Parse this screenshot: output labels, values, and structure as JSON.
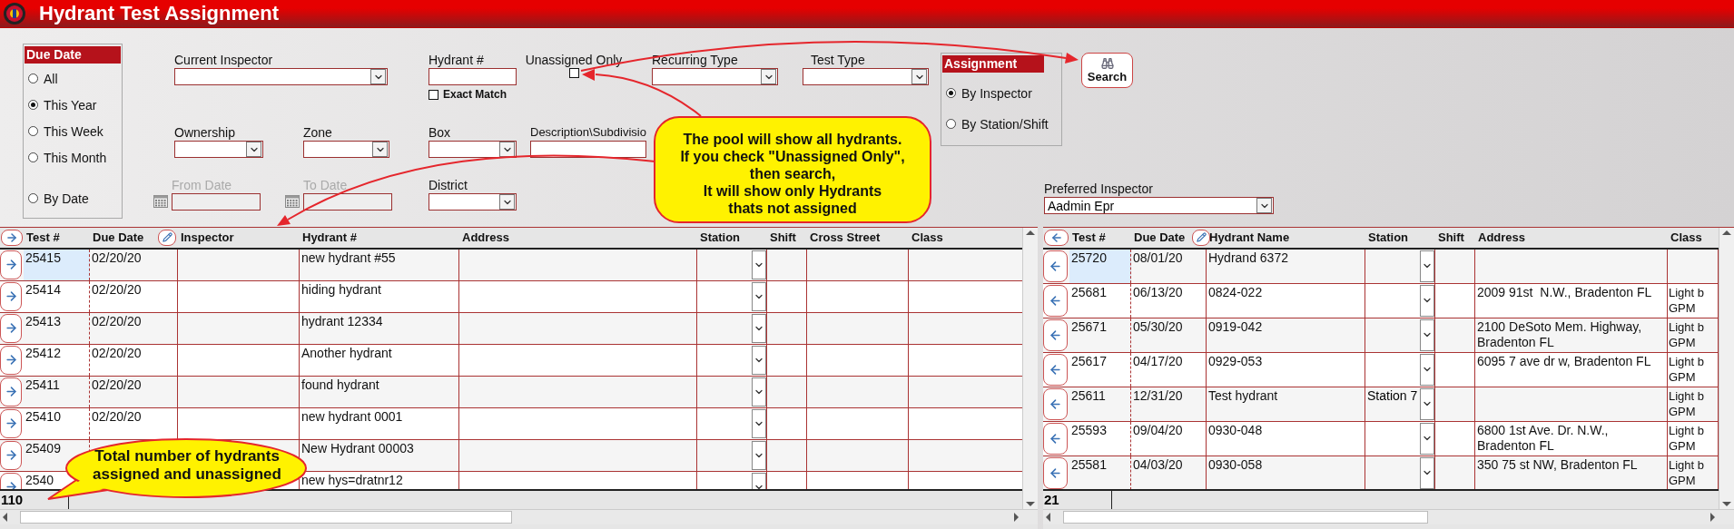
{
  "window": {
    "title": "Hydrant Test Assignment"
  },
  "due_date": {
    "title": "Due Date",
    "options": [
      {
        "label": "All",
        "selected": false
      },
      {
        "label": "This Year",
        "selected": true
      },
      {
        "label": "This Week",
        "selected": false
      },
      {
        "label": "This Month",
        "selected": false
      },
      {
        "label": "By Date",
        "selected": false
      }
    ]
  },
  "filter_rows": [
    [
      {
        "kind": "select",
        "label": "Current Inspector",
        "disabled": false
      },
      {
        "kind": "text",
        "label": "Hydrant #",
        "disabled": false,
        "option": {
          "label": "Exact Match",
          "checked": false
        }
      },
      {
        "kind": "checkbox",
        "label": "Unassigned Only",
        "disabled": false,
        "checked": false
      },
      {
        "kind": "select",
        "label": "Recurring Type",
        "disabled": false
      },
      {
        "kind": "select",
        "label": "Test Type",
        "disabled": false
      }
    ],
    [
      {
        "kind": "select",
        "label": "Ownership",
        "disabled": false
      },
      {
        "kind": "select",
        "label": "Zone",
        "disabled": false
      },
      {
        "kind": "select",
        "label": "Box",
        "disabled": false
      },
      {
        "kind": "text",
        "label": "Description\\Subdivisio",
        "disabled": false
      }
    ],
    [
      {
        "kind": "date",
        "label": "From Date",
        "disabled": true
      },
      {
        "kind": "date",
        "label": "To Date",
        "disabled": true
      },
      {
        "kind": "select",
        "label": "District",
        "disabled": false
      }
    ]
  ],
  "assignment": {
    "title": "Assignment",
    "options": [
      {
        "label": "By Inspector",
        "selected": true
      },
      {
        "label": "By Station/Shift",
        "selected": false
      }
    ]
  },
  "search_button": {
    "label": "Search"
  },
  "preferred_inspector": {
    "label": "Preferred Inspector",
    "value": "Aadmin Epr"
  },
  "pool_table": {
    "columns": [
      "Test #",
      "Due Date",
      "Inspector",
      "Hydrant #",
      "Address",
      "Station",
      "Shift",
      "Cross Street",
      "Class"
    ],
    "rows": [
      {
        "test": "25415",
        "due_date": "02/20/20",
        "hydrant": "new hydrant #55",
        "selected": true
      },
      {
        "test": "25414",
        "due_date": "02/20/20",
        "hydrant": "hiding hydrant",
        "selected": false
      },
      {
        "test": "25413",
        "due_date": "02/20/20",
        "hydrant": "hydrant 12334",
        "selected": false
      },
      {
        "test": "25412",
        "due_date": "02/20/20",
        "hydrant": "Another hydrant",
        "selected": false
      },
      {
        "test": "25411",
        "due_date": "02/20/20",
        "hydrant": "found hydrant",
        "selected": false
      },
      {
        "test": "25410",
        "due_date": "02/20/20",
        "hydrant": "new hydrant 0001",
        "selected": false
      },
      {
        "test": "25409",
        "hydrant": "New Hydrant 00003",
        "selected": false
      },
      {
        "test": "2540",
        "hydrant": "new hys=dratnr12",
        "selected": false
      }
    ],
    "total": "110"
  },
  "assigned_table": {
    "columns": [
      "Test #",
      "Due Date",
      "Hydrant Name",
      "Station",
      "Shift",
      "Address",
      "Class"
    ],
    "rows": [
      {
        "test": "25720",
        "due_date": "08/01/20",
        "hydrant": "Hydrand 6372",
        "selected": true
      },
      {
        "test": "25681",
        "due_date": "06/13/20",
        "hydrant": "0824-022",
        "address": "2009 91st  N.W., Bradenton FL",
        "class": [
          "Light b",
          "GPM"
        ],
        "selected": false
      },
      {
        "test": "25671",
        "due_date": "05/30/20",
        "hydrant": "0919-042",
        "address": "2100 DeSoto Mem. Highway, Bradenton FL",
        "class": [
          "Light b",
          "GPM"
        ],
        "selected": false
      },
      {
        "test": "25617",
        "due_date": "04/17/20",
        "hydrant": "0929-053",
        "address": "6095 7 ave dr w, Bradenton FL",
        "class": [
          "Light b",
          "GPM"
        ],
        "selected": false
      },
      {
        "test": "25611",
        "due_date": "12/31/20",
        "hydrant": "Test hydrant",
        "station": "Station 7",
        "class": [
          "Light b",
          "GPM"
        ],
        "selected": false
      },
      {
        "test": "25593",
        "due_date": "09/04/20",
        "hydrant": "0930-048",
        "address": "6800 1st Ave. Dr. N.W., Bradenton FL",
        "class": [
          "Light b",
          "GPM"
        ],
        "selected": false
      },
      {
        "test": "25581",
        "due_date": "04/03/20",
        "hydrant": "0930-058",
        "address": "350 75 st NW, Bradenton FL",
        "class": [
          "Light b",
          "GPM"
        ],
        "selected": false
      }
    ],
    "total": "21"
  },
  "callouts": [
    {
      "kind": "box",
      "lines": [
        "The pool will show all hydrants.",
        "If you check \"Unassigned Only\",",
        "then search,",
        "It will show only Hydrants",
        "thats not assigned"
      ]
    },
    {
      "kind": "bubble",
      "lines": [
        "Total number of hydrants",
        "assigned and unassigned"
      ]
    }
  ]
}
